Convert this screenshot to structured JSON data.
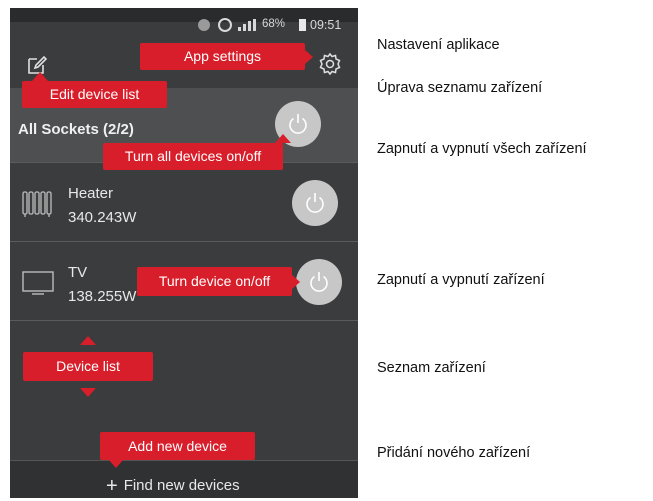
{
  "status_bar": {
    "battery": "68%",
    "time": "09:51"
  },
  "tooltips": {
    "app_settings": "App settings",
    "edit_device_list": "Edit device list",
    "turn_all": "Turn all devices on/off",
    "turn_device": "Turn device on/off",
    "device_list": "Device list",
    "add_device": "Add new device"
  },
  "all_sockets": {
    "label": "All Sockets (2/2)"
  },
  "devices": [
    {
      "name": "Heater",
      "power": "340.243W",
      "icon": "heater-icon"
    },
    {
      "name": "TV",
      "power": "138.255W",
      "icon": "tv-icon"
    }
  ],
  "footer": {
    "find_label": "Find new devices"
  },
  "captions": {
    "settings": "Nastavení aplikace",
    "edit_list": "Úprava seznamu zařízení",
    "turn_all": "Zapnutí a vypnutí všech zařízení",
    "turn_device": "Zapnutí a vypnutí zařízení",
    "device_list": "Seznam zařízení",
    "add_device": "Přidání nového zařízení"
  },
  "colors": {
    "accent_red": "#d81e2a",
    "app_background": "#3b3c3e",
    "selected_row": "#4e4f51",
    "power_button": "#c7c7c7"
  }
}
